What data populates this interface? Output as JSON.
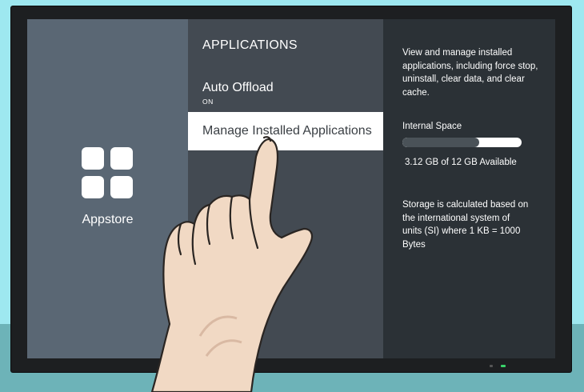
{
  "left_panel": {
    "app_label": "Appstore",
    "icon": "grid-apps-icon"
  },
  "middle_panel": {
    "section_title": "APPLICATIONS",
    "items": [
      {
        "title": "Auto Offload",
        "subtitle": "ON"
      },
      {
        "title": "Manage Installed Applications"
      }
    ]
  },
  "right_panel": {
    "description": "View and manage installed applications, including force stop, uninstall, clear data, and clear cache.",
    "internal_space_label": "Internal Space",
    "storage_text": "3.12 GB of 12 GB Available",
    "storage_used_fraction": 0.6466,
    "note": "Storage is calculated based on the international system of units (SI) where 1 KB = 1000 Bytes"
  },
  "colors": {
    "left_panel": "#5a6774",
    "middle_panel": "#434a52",
    "right_panel": "#2b3136",
    "selected_item": "#ffffff"
  }
}
